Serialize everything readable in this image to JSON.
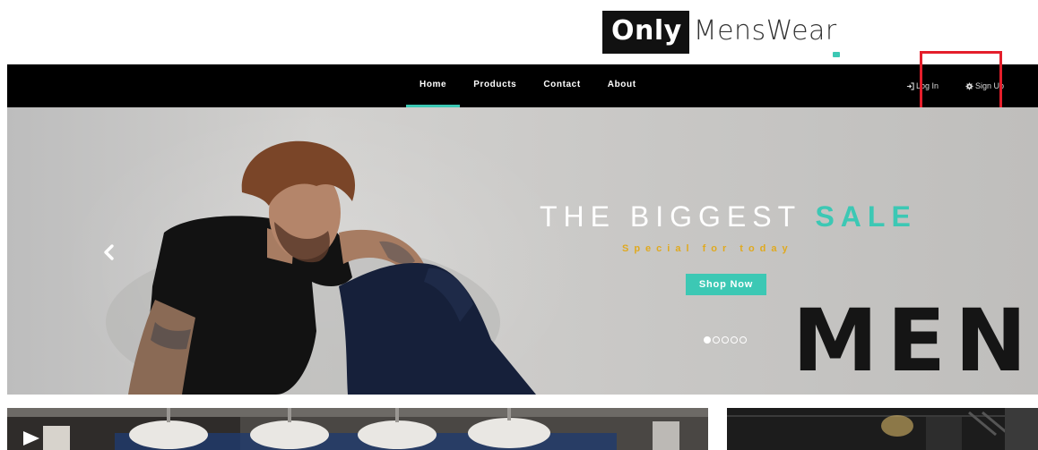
{
  "logo": {
    "part1": "Only",
    "part2": "MensWear"
  },
  "nav": {
    "links": [
      {
        "label": "Home",
        "active": true
      },
      {
        "label": "Products",
        "active": false
      },
      {
        "label": "Contact",
        "active": false
      },
      {
        "label": "About",
        "active": false
      }
    ],
    "login_label": "Log In",
    "signup_label": "Sign Up"
  },
  "hero": {
    "title_main": "THE BIGGEST ",
    "title_accent": "SALE",
    "subtitle": "Special for today",
    "button_label": "Shop Now",
    "big_text": "MEN’",
    "slide_count": 5,
    "active_slide": 1
  },
  "colors": {
    "accent": "#3cc8b4",
    "highlight": "#e41e2b",
    "gold": "#e0a91e",
    "navbar": "#000000"
  },
  "icons": {
    "login": "sign-in-icon",
    "signup": "gear-icon",
    "prev": "chevron-left-icon"
  }
}
